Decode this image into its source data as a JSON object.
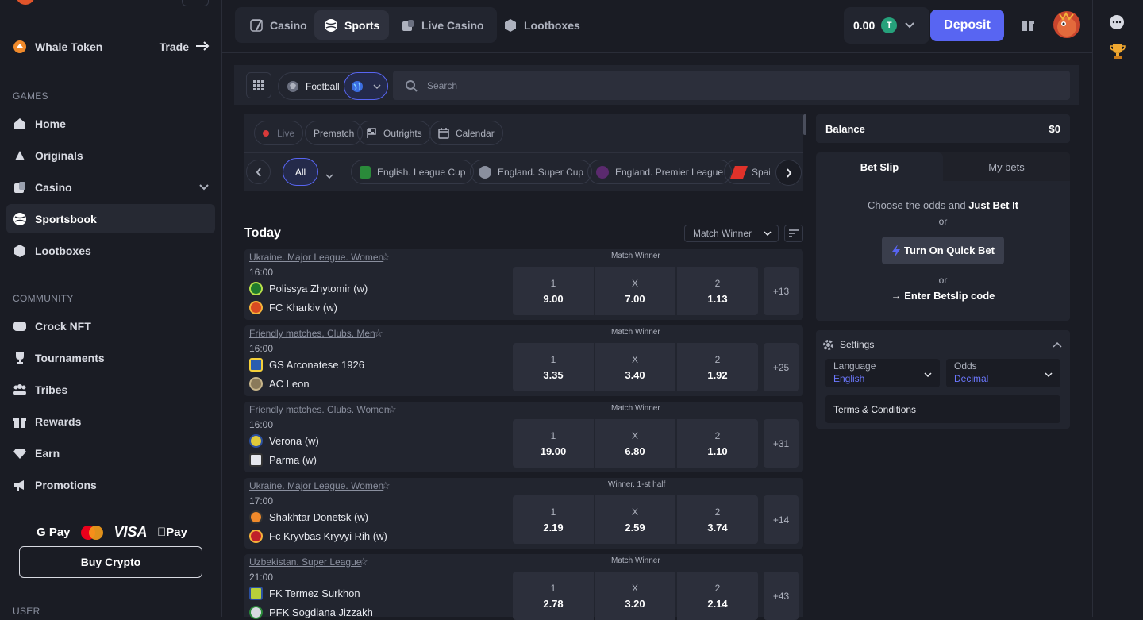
{
  "sidebar": {
    "token": {
      "name": "Whale Token",
      "trade": "Trade"
    },
    "games_header": "GAMES",
    "games": [
      {
        "label": "Home",
        "icon": "home-icon"
      },
      {
        "label": "Originals",
        "icon": "originals-icon"
      },
      {
        "label": "Casino",
        "icon": "casino-icon"
      },
      {
        "label": "Sportsbook",
        "icon": "sportsbook-icon"
      },
      {
        "label": "Lootboxes",
        "icon": "lootbox-icon"
      }
    ],
    "community_header": "COMMUNITY",
    "community": [
      {
        "label": "Crock NFT",
        "icon": "nft-icon"
      },
      {
        "label": "Tournaments",
        "icon": "trophy-icon"
      },
      {
        "label": "Tribes",
        "icon": "tribes-icon"
      },
      {
        "label": "Rewards",
        "icon": "gift-icon"
      },
      {
        "label": "Earn",
        "icon": "diamond-icon"
      },
      {
        "label": "Promotions",
        "icon": "megaphone-icon"
      }
    ],
    "payments": {
      "gpay": "G Pay",
      "visa": "VISA",
      "apple": "Pay"
    },
    "buy_crypto": "Buy Crypto",
    "user_header": "USER"
  },
  "topnav": {
    "tabs": [
      {
        "label": "Casino",
        "icon": "casino-icon"
      },
      {
        "label": "Sports",
        "icon": "sports-icon"
      },
      {
        "label": "Live Casino",
        "icon": "live-casino-icon"
      },
      {
        "label": "Lootboxes",
        "icon": "lootbox-icon"
      }
    ],
    "balance": "0.00",
    "currency": "T",
    "deposit": "Deposit"
  },
  "filters": {
    "sport": "Football",
    "search_placeholder": "Search",
    "modes": {
      "live": "Live",
      "prematch": "Prematch",
      "outrights": "Outrights",
      "calendar": "Calendar"
    },
    "all": "All",
    "leagues": [
      "English. League Cup",
      "England. Super Cup",
      "England. Premier League",
      "Spain"
    ]
  },
  "section": {
    "title": "Today",
    "market_select": "Match Winner"
  },
  "matches": [
    {
      "league": "Ukraine. Major League. Women",
      "time": "16:00",
      "team1": "Polissya Zhytomir (w)",
      "team2": "FC Kharkiv (w)",
      "market": "Match Winner",
      "o1": "9.00",
      "ox": "7.00",
      "o2": "1.13",
      "more": "+13",
      "lbl1": "1",
      "lblx": "X",
      "lbl2": "2"
    },
    {
      "league": "Friendly matches. Clubs. Men",
      "time": "16:00",
      "team1": "GS Arconatese 1926",
      "team2": "AC Leon",
      "market": "Match Winner",
      "o1": "3.35",
      "ox": "3.40",
      "o2": "1.92",
      "more": "+25",
      "lbl1": "1",
      "lblx": "X",
      "lbl2": "2"
    },
    {
      "league": "Friendly matches. Clubs. Women",
      "time": "16:00",
      "team1": "Verona (w)",
      "team2": "Parma (w)",
      "market": "Match Winner",
      "o1": "19.00",
      "ox": "6.80",
      "o2": "1.10",
      "more": "+31",
      "lbl1": "1",
      "lblx": "X",
      "lbl2": "2"
    },
    {
      "league": "Ukraine. Major League. Women",
      "time": "17:00",
      "team1": "Shakhtar Donetsk (w)",
      "team2": "Fc Kryvbas Kryvyi Rih (w)",
      "market": "Winner. 1-st half",
      "o1": "2.19",
      "ox": "2.59",
      "o2": "3.74",
      "more": "+14",
      "lbl1": "1",
      "lblx": "X",
      "lbl2": "2"
    },
    {
      "league": "Uzbekistan. Super League",
      "time": "21:00",
      "team1": "FK Termez Surkhon",
      "team2": "PFK Sogdiana Jizzakh",
      "market": "Match Winner",
      "o1": "2.78",
      "ox": "3.20",
      "o2": "2.14",
      "more": "+43",
      "lbl1": "1",
      "lblx": "X",
      "lbl2": "2"
    }
  ],
  "betslip": {
    "balance_label": "Balance",
    "balance_value": "$0",
    "tab_slip": "Bet Slip",
    "tab_mybets": "My bets",
    "choose": "Choose the odds and",
    "just_bet": "Just Bet It",
    "or1": "or",
    "quick_bet": "Turn On Quick Bet",
    "or2": "or",
    "enter_code": "→ Enter Betslip code"
  },
  "settings": {
    "title": "Settings",
    "language_label": "Language",
    "language_value": "English",
    "odds_label": "Odds",
    "odds_value": "Decimal",
    "terms": "Terms & Conditions"
  },
  "colors": {
    "accent": "#5865f2",
    "bg": "#1a1c24",
    "card": "#22252f"
  }
}
